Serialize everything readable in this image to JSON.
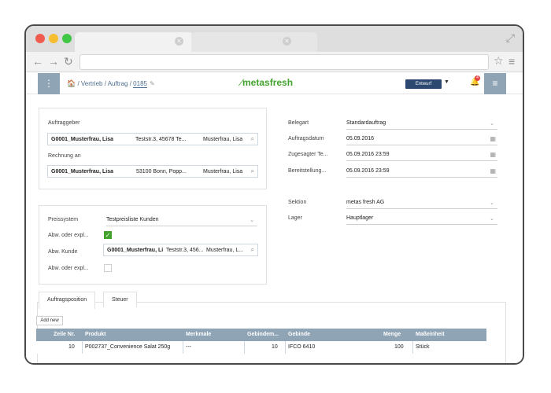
{
  "app": {
    "logo_text": "metasfresh",
    "breadcrumb": {
      "home": "🏠",
      "sep1": " / ",
      "part1": "Vertrieb",
      "sep2": " / ",
      "part2": "Auftrag",
      "sep3": " / ",
      "doc_no": "0185"
    },
    "status_label": "Entwurf",
    "notification_count": "4"
  },
  "panel_customer": {
    "auftraggeber_label": "Auftraggeber",
    "auftraggeber": {
      "name": "G0001_Musterfrau, Lisa",
      "address": "Teststr.3, 45678 Te...",
      "contact": "Musterfrau, Lisa"
    },
    "rechnung_label": "Rechnung an",
    "rechnung": {
      "name": "G0001_Musterfrau, Lisa",
      "address": "53100 Bonn, Popp...",
      "contact": "Musterfrau, Lisa"
    }
  },
  "panel_order": {
    "belegart_label": "Belegart",
    "belegart": "Standardauftrag",
    "auftragsdatum_label": "Auftragsdatum",
    "auftragsdatum": "05.09.2016",
    "zugesagter_label": "Zugesagter Te...",
    "zugesagter": "05.09.2016 23:59",
    "bereitstellung_label": "Bereitstellung...",
    "bereitstellung": "05.09.2016 23:59",
    "sektion_label": "Sektion",
    "sektion": "metas fresh AG",
    "lager_label": "Lager",
    "lager": "Hauptlager"
  },
  "panel_pricing": {
    "preissystem_label": "Preissystem",
    "preissystem": "Testpreisliste Kunden",
    "abw1_label": "Abw. oder expl...",
    "abw_kunde_label": "Abw. Kunde",
    "abw_kunde": {
      "name": "G0001_Musterfrau, Li",
      "address": "Teststr.3, 456...",
      "contact": "Musterfrau, L..."
    },
    "abw2_label": "Abw. oder expl..."
  },
  "tabs": [
    "Auftragsposition",
    "Steuer"
  ],
  "grid": {
    "add_new": "Add new",
    "headers": [
      "Zeile Nr.",
      "Produkt",
      "Merkmale",
      "Gebindem...",
      "Gebinde",
      "Menge",
      "Maßeinheit"
    ],
    "row": [
      "10",
      "P002737_Convenience Salat 250g",
      "---",
      "10",
      "IFCO 6410",
      "100",
      "Stück"
    ]
  },
  "colors": {
    "accent": "#43a32e",
    "header_blue": "#8fa4b5",
    "status_dark": "#2c4770"
  }
}
